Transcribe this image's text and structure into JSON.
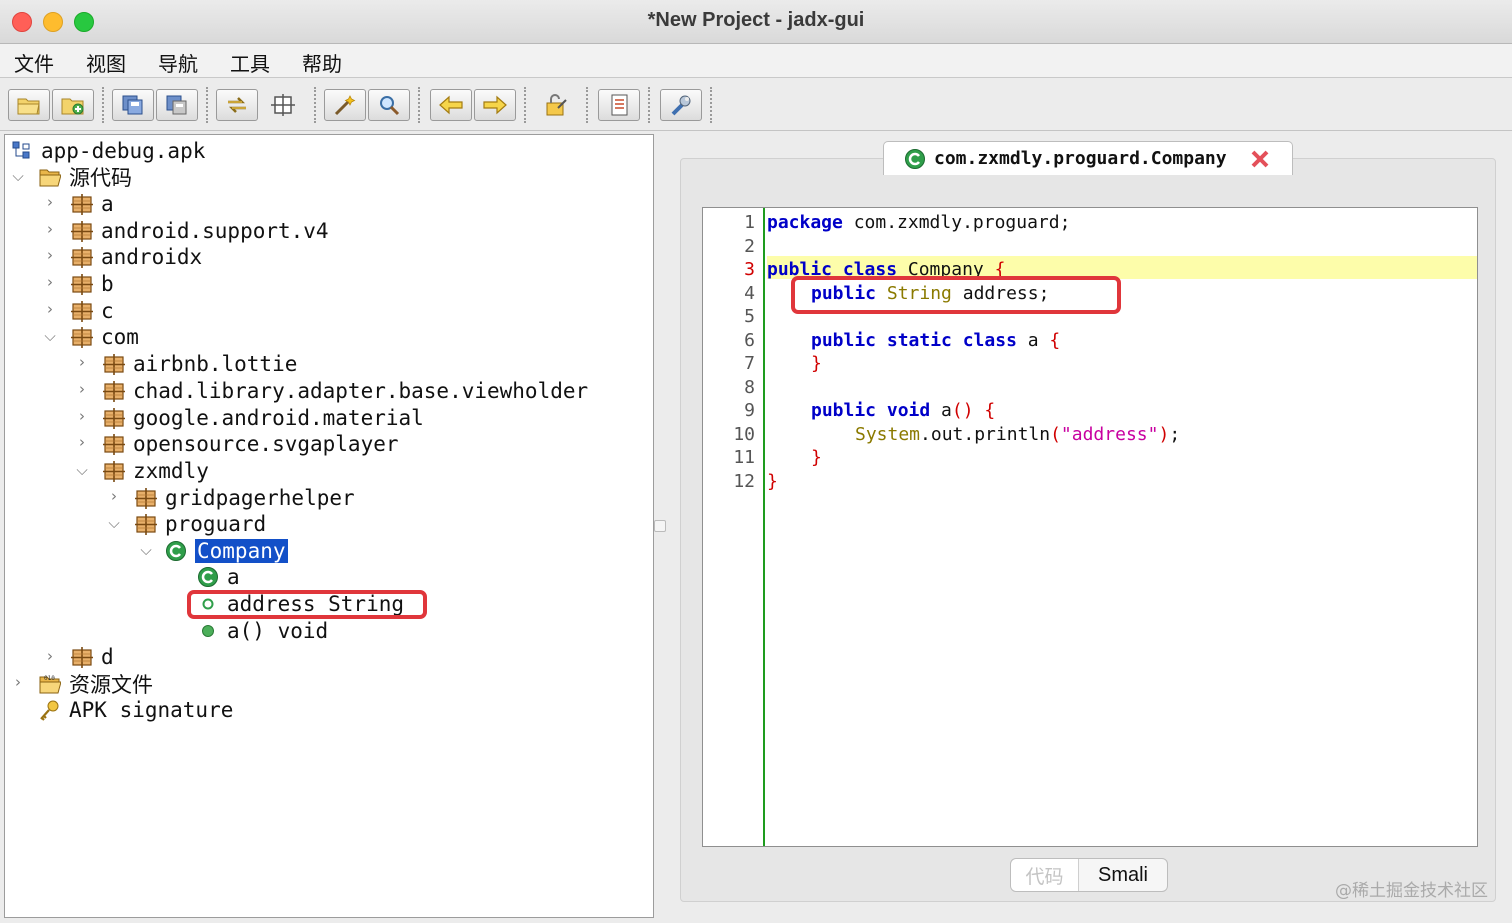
{
  "window": {
    "title": "*New Project - jadx-gui"
  },
  "menu": [
    "文件",
    "视图",
    "导航",
    "工具",
    "帮助"
  ],
  "toolbar": {
    "buttons": [
      "open-file-icon",
      "add-file-icon",
      "save-all-icon",
      "export-icon",
      "sync-icon",
      "flatten-packages-icon",
      "text-search-icon",
      "class-search-icon",
      "back-icon",
      "forward-icon",
      "deobfuscation-icon",
      "log-icon",
      "preferences-icon"
    ]
  },
  "tree": {
    "root": "app-debug.apk",
    "source": "源代码",
    "pkg_a": "a",
    "pkg_support": "android.support.v4",
    "pkg_androidx": "androidx",
    "pkg_b": "b",
    "pkg_c": "c",
    "pkg_com": "com",
    "pkg_lottie": "airbnb.lottie",
    "pkg_chad": "chad.library.adapter.base.viewholder",
    "pkg_material": "google.android.material",
    "pkg_svga": "opensource.svgaplayer",
    "pkg_zxmdly": "zxmdly",
    "pkg_grid": "gridpagerhelper",
    "pkg_proguard": "proguard",
    "class_company": "Company",
    "class_a": "a",
    "field_address": "address String",
    "method_a": "a() void",
    "pkg_d": "d",
    "resources": "资源文件",
    "signature": "APK signature"
  },
  "editor": {
    "tab_title": "com.zxmdly.proguard.Company",
    "current_line": 3,
    "line_numbers": [
      "1",
      "2",
      "3",
      "4",
      "5",
      "6",
      "7",
      "8",
      "9",
      "10",
      "11",
      "12"
    ],
    "code": {
      "l1_kw": "package",
      "l1_rest": " com.zxmdly.proguard;",
      "l3_kw": "public class",
      "l3_name": " Company ",
      "l3_brace": "{",
      "l4_kw": "public",
      "l4_type": " String",
      "l4_rest": " address;",
      "l6_kw": "public static class",
      "l6_name": " a ",
      "l6_brace": "{",
      "l7_brace": "}",
      "l9_kw": "public void",
      "l9_name": " a",
      "l9_paren": "()",
      "l9_brace": " {",
      "l10_type": "System",
      "l10_mid": ".out.println",
      "l10_lp": "(",
      "l10_str": "\"address\"",
      "l10_rp": ")",
      "l10_end": ";",
      "l11_brace": "}",
      "l12_brace": "}"
    }
  },
  "bottom_tabs": {
    "code": "代码",
    "smali": "Smali"
  },
  "watermark": "@稀土掘金技术社区"
}
